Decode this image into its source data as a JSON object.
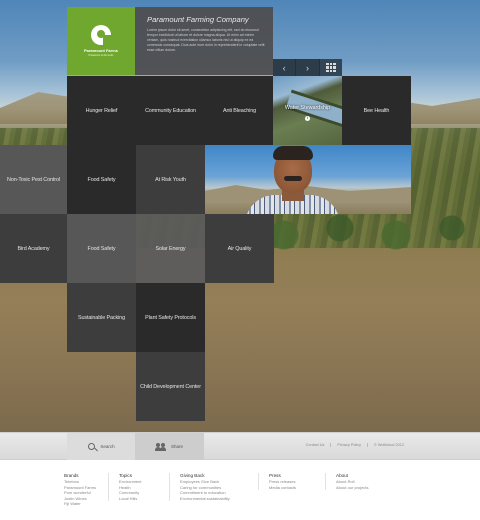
{
  "brand": {
    "logo_name": "Paramount Farms",
    "logo_tagline": "Pistachios & Almonds",
    "company": "Paramount Farming Company",
    "intro": "Lorem ipsum dolor sit amet, consectetur adipisicing elit, sed do eiusmod tempor incididunt ut labore et dolore magna aliqua. Ut enim ad minim veniam, quis nostrud exercitation ullamco laboris nisi ut aliquip ex ea commodo consequat. Duis aute irure dolor in reprehenderit in voluptate velit esse cillum dolore."
  },
  "nav": {
    "prev": "‹",
    "next": "›",
    "grid_icon": "grid-icon"
  },
  "tiles": {
    "hunger_relief": "Hunger Relief",
    "community_education": "Community Education",
    "anti_bleaching": "Anti Bleaching",
    "water_stewardship": "Water Stewardship",
    "bee_health": "Bee Health",
    "non_toxic_pest_control": "Non-Toxic Pest Control",
    "food_safety": "Food Safety",
    "at_risk_youth": "At Risk Youth",
    "bird_academy": "Bird Academy",
    "food_safety_2": "Food Safety",
    "solar_energy": "Solar Energy",
    "air_quality": "Air Quality",
    "sustainable_packing": "Sustainable Packing",
    "plant_safety_protocols": "Plant Safety Protocols",
    "child_development_center": "Child Development Center",
    "info_badge": "i"
  },
  "footer_bar": {
    "search": "Search",
    "share": "Share",
    "links": [
      "Contact Us",
      "Privacy Policy",
      "© Wolfcloud 2012"
    ]
  },
  "footer": {
    "columns": [
      {
        "heading": "Brands",
        "items": [
          "Telefono",
          "Paramount Farms",
          "Pom wonderful",
          "Justin Wines",
          "Fiji Water"
        ]
      },
      {
        "heading": "Topics",
        "items": [
          "Environment",
          "Health",
          "Community",
          "Local Hills"
        ]
      },
      {
        "heading": "Giving Back",
        "items": [
          "Employees Give Back",
          "Caring for communities",
          "Commitment to education",
          "Environmental sustainability"
        ]
      },
      {
        "heading": "Press",
        "items": [
          "Press releases",
          "Media contacts"
        ]
      },
      {
        "heading": "About",
        "items": [
          "About Roll",
          "About our projects"
        ]
      }
    ]
  }
}
